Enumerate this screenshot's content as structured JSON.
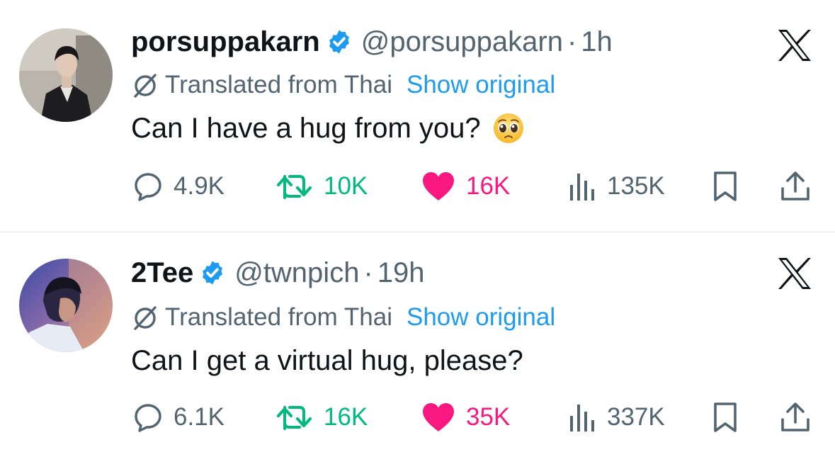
{
  "translation": {
    "label": "Translated from Thai",
    "show_original": "Show original"
  },
  "colors": {
    "text": "#0f1419",
    "secondary": "#536471",
    "link_blue": "#1d9bf0",
    "verified_blue": "#1d9bf0",
    "retweet_green": "#00ba7c",
    "like_pink": "#f91880",
    "divider": "#dfe3e8"
  },
  "tweets": [
    {
      "display_name": "porsuppakarn",
      "handle": "@porsuppakarn",
      "separator": "·",
      "time": "1h",
      "text": "Can I have a hug from you?",
      "emoji_icon": "pleading-face-emoji",
      "stats": {
        "replies": "4.9K",
        "reposts": "10K",
        "likes": "16K",
        "views": "135K"
      }
    },
    {
      "display_name": "2Tee",
      "handle": "@twnpich",
      "separator": "·",
      "time": "19h",
      "text": "Can I get a virtual hug, please?",
      "stats": {
        "replies": "6.1K",
        "reposts": "16K",
        "likes": "35K",
        "views": "337K"
      }
    }
  ]
}
